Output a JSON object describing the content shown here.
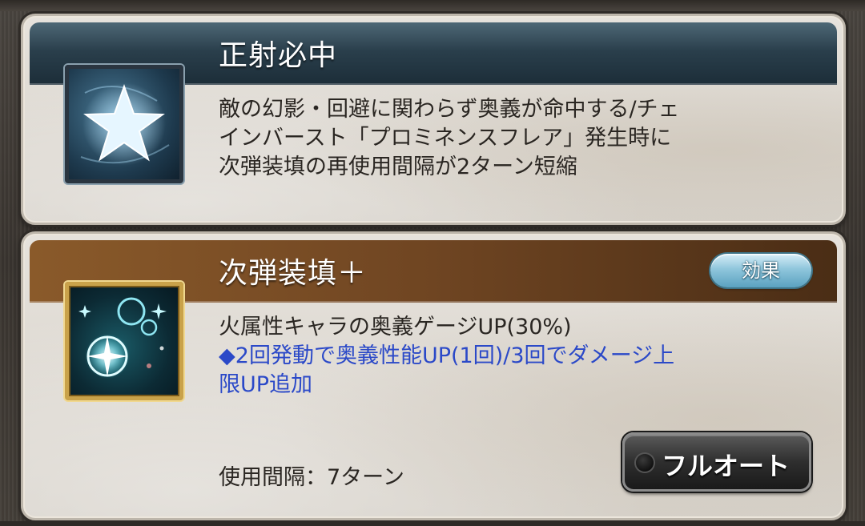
{
  "skills": [
    {
      "name": "正射必中",
      "icon": "star-icon",
      "description_lines": [
        "敵の幻影・回避に関わらず奥義が命中する/チェ",
        "インバースト「プロミネンスフレア」発生時に",
        "次弾装填の再使用間隔が2ターン短縮"
      ]
    },
    {
      "name": "次弾装填＋",
      "icon": "sparkle-orbs-icon",
      "effect_button_label": "効果",
      "description_lines": [
        "火属性キャラの奥義ゲージUP(30%)"
      ],
      "extra_lines": [
        "◆2回発動で奥義性能UP(1回)/3回でダメージ上",
        "限UP追加"
      ],
      "cooldown": "使用間隔：7ターン",
      "auto_button_label": "フルオート"
    }
  ],
  "colors": {
    "skill1_header": "#2a3f4c",
    "skill2_header": "#6f4522",
    "extra_text": "#2b49c8",
    "effect_button": "#8fc6dc"
  }
}
